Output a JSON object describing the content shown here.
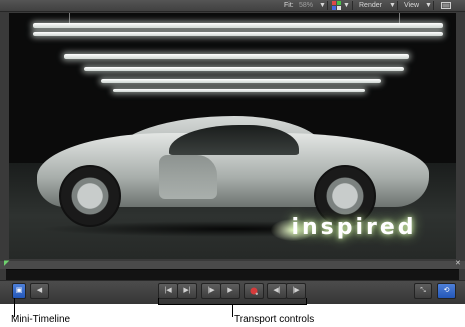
{
  "toolbar": {
    "fit_label": "Fit:",
    "fit_value": "58%",
    "render_label": "Render",
    "view_label": "View"
  },
  "canvas": {
    "overlay_text": "inspired"
  },
  "transport": {
    "colors": {
      "accent": "#2f64c6",
      "record": "#d63b3b"
    }
  },
  "callouts": {
    "mini_timeline": "Mini-Timeline",
    "transport_controls": "Transport controls"
  },
  "icons": [
    "channel-icon",
    "chevron-down-icon",
    "layout-icon",
    "timeline-toggle-icon",
    "previous-icon",
    "go-to-start-icon",
    "go-to-end-icon",
    "step-back-icon",
    "play-icon",
    "record-icon",
    "step-backward-frame-icon",
    "step-forward-frame-icon",
    "fullscreen-icon",
    "loop-icon"
  ]
}
